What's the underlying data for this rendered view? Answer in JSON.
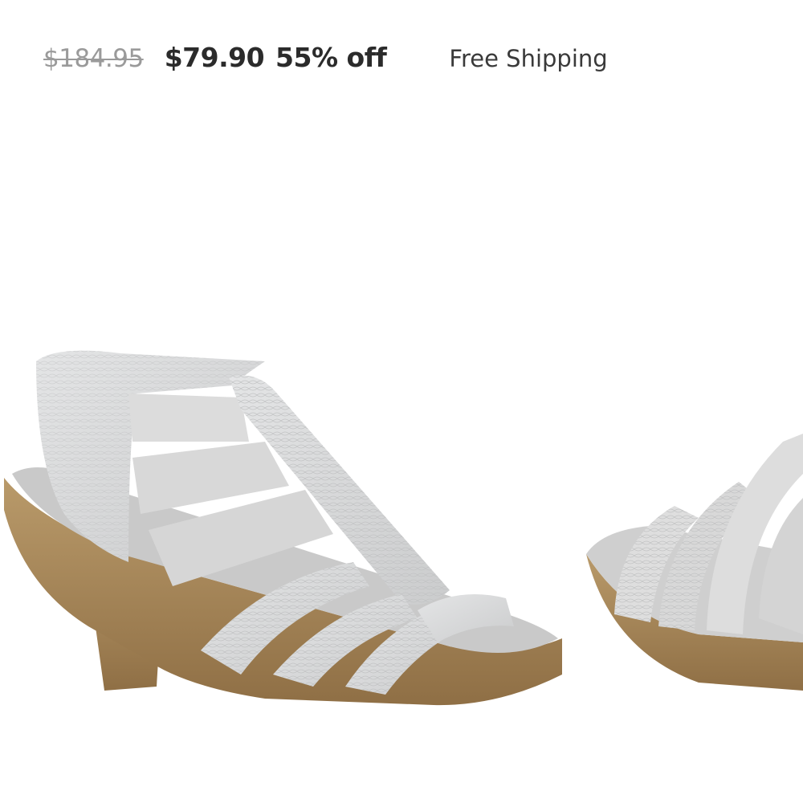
{
  "pricing": {
    "original_price": "$184.95",
    "sale_price": "$79.90",
    "discount": "55% off",
    "shipping": "Free Shipping"
  },
  "gallery": {
    "images": [
      {
        "alt": "Light grey snake-embossed strappy heeled sandal, side view"
      },
      {
        "alt": "Light grey strappy sandal, partial front view"
      }
    ]
  },
  "colors": {
    "sale_text": "#2b2b2b",
    "original_text": "#9a9a9a",
    "sandal_upper": "#d9dadb",
    "sandal_base": "#a98a5c"
  }
}
